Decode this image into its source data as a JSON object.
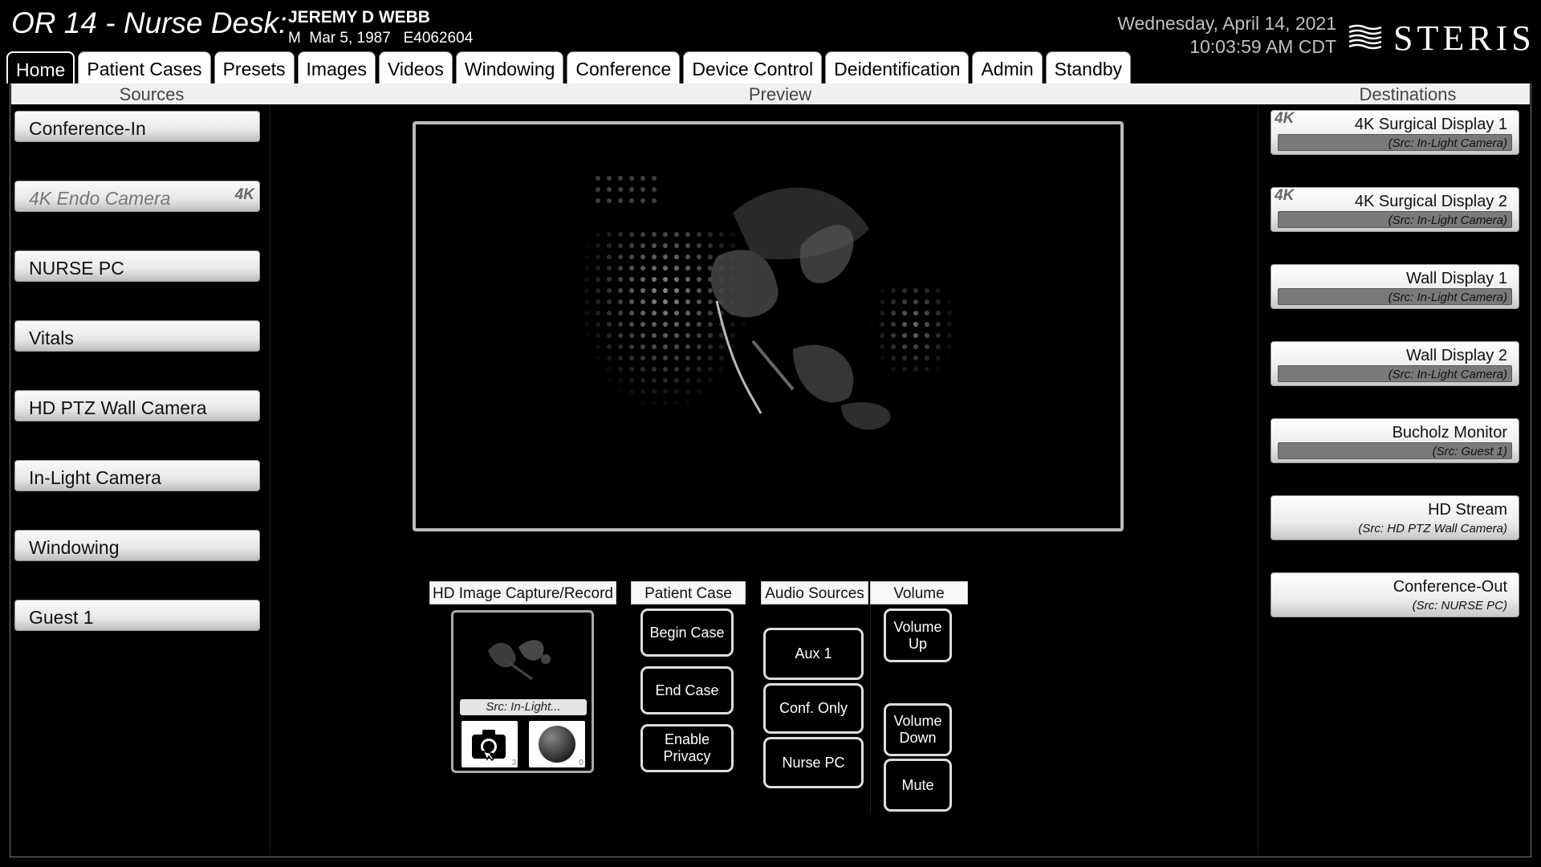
{
  "header": {
    "title": "OR 14 - Nurse Desk:",
    "patient_name": "JEREMY D WEBB",
    "patient_details": "M  Mar 5, 1987   E4062604",
    "date": "Wednesday, April 14, 2021",
    "time": "10:03:59 AM CDT",
    "logo_text": "STERIS"
  },
  "tabs": [
    {
      "label": "Home",
      "active": true
    },
    {
      "label": "Patient Cases"
    },
    {
      "label": "Presets"
    },
    {
      "label": "Images"
    },
    {
      "label": "Videos"
    },
    {
      "label": "Windowing"
    },
    {
      "label": "Conference"
    },
    {
      "label": "Device Control"
    },
    {
      "label": "Deidentification"
    },
    {
      "label": "Admin"
    },
    {
      "label": "Standby"
    }
  ],
  "sections": {
    "sources": "Sources",
    "preview": "Preview",
    "destinations": "Destinations"
  },
  "sources": [
    {
      "label": "Conference-In"
    },
    {
      "label": "4K Endo Camera",
      "badge": "4K",
      "disabled": true
    },
    {
      "label": "NURSE PC"
    },
    {
      "label": "Vitals"
    },
    {
      "label": "HD PTZ Wall Camera"
    },
    {
      "label": "In-Light Camera",
      "selected": true
    },
    {
      "label": "Windowing"
    },
    {
      "label": "Guest 1"
    }
  ],
  "capture": {
    "header": "HD Image Capture/Record",
    "source": "Src: In-Light...",
    "photo_count": "3",
    "record_count": "0",
    "icons": [
      "camera-icon",
      "record-icon"
    ]
  },
  "patient_case": {
    "header": "Patient Case",
    "begin": "Begin Case",
    "end": "End Case",
    "privacy": "Enable Privacy"
  },
  "audio": {
    "header": "Audio Sources",
    "aux": "Aux 1",
    "conf": "Conf. Only",
    "nurse": "Nurse PC"
  },
  "volume": {
    "header": "Volume",
    "up": "Volume Up",
    "down": "Volume Down",
    "mute": "Mute"
  },
  "destinations": [
    {
      "name": "4K Surgical Display 1",
      "src": "(Src: In-Light Camera)",
      "badge": "4K",
      "bar": true
    },
    {
      "name": "4K Surgical Display 2",
      "src": "(Src: In-Light Camera)",
      "badge": "4K",
      "bar": true
    },
    {
      "name": "Wall Display 1",
      "src": "(Src: In-Light Camera)",
      "bar": true
    },
    {
      "name": "Wall Display 2",
      "src": "(Src: In-Light Camera)",
      "bar": true
    },
    {
      "name": "Bucholz Monitor",
      "src": "(Src: Guest 1)",
      "bar": true
    },
    {
      "name": "HD Stream",
      "src": "(Src: HD PTZ Wall Camera)",
      "bar": false
    },
    {
      "name": "Conference-Out",
      "src": "(Src: NURSE PC)",
      "bar": false
    }
  ]
}
